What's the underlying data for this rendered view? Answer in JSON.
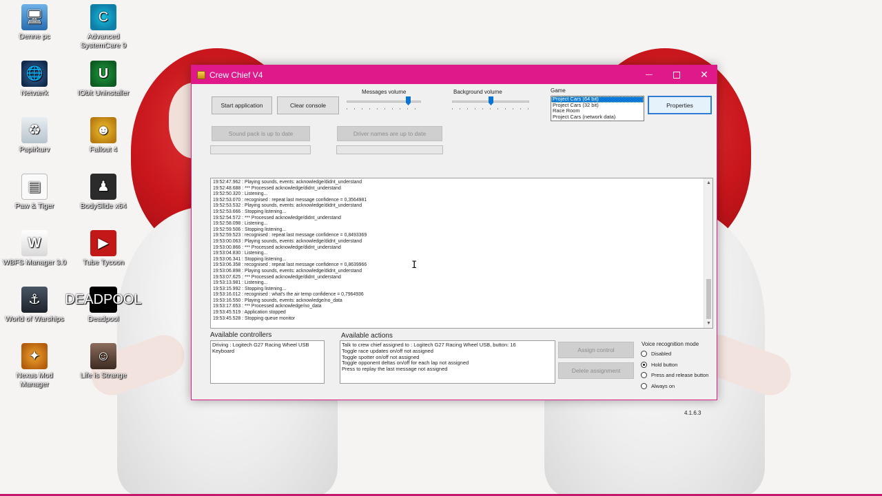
{
  "desktop": {
    "icons": [
      {
        "key": "pc",
        "label": "Denne pc",
        "glyph": "🖥"
      },
      {
        "key": "asc",
        "label": "Advanced SystemCare 9",
        "glyph": "C"
      },
      {
        "key": "net",
        "label": "Netværk",
        "glyph": "🌐"
      },
      {
        "key": "iobit",
        "label": "IObit Uninstaller",
        "glyph": "U"
      },
      {
        "key": "bin",
        "label": "Papirkurv",
        "glyph": "♻"
      },
      {
        "key": "fallout",
        "label": "Fallout 4",
        "glyph": "☻"
      },
      {
        "key": "paw",
        "label": "Paw & Tiger",
        "glyph": "▤"
      },
      {
        "key": "body",
        "label": "BodySlide x64",
        "glyph": "♟"
      },
      {
        "key": "wbfs",
        "label": "WBFS Manager 3.0",
        "glyph": "W"
      },
      {
        "key": "tube",
        "label": "Tube Tycoon",
        "glyph": "▶"
      },
      {
        "key": "wows",
        "label": "World of Warships",
        "glyph": "⚓"
      },
      {
        "key": "deadpool",
        "label": "Deadpool",
        "glyph": "DEADPOOL"
      },
      {
        "key": "nexus",
        "label": "Nexus Mod Manager",
        "glyph": "✦"
      },
      {
        "key": "life",
        "label": "Life is Strange",
        "glyph": "☺"
      }
    ]
  },
  "window": {
    "title": "Crew Chief V4",
    "controls": {
      "minimize": "—",
      "close": "✕"
    },
    "accent": "#e0198a"
  },
  "toolbar": {
    "start_label": "Start application",
    "clear_label": "Clear console",
    "messages_volume_label": "Messages volume",
    "background_volume_label": "Background volume",
    "messages_volume": 0.85,
    "background_volume": 0.5,
    "game_label": "Game",
    "properties_label": "Properties",
    "sound_pack_label": "Sound pack is up to date",
    "driver_names_label": "Driver names are up to date"
  },
  "games": [
    {
      "name": "Project Cars (64 bit)",
      "selected": true
    },
    {
      "name": "Project Cars (32 bit)",
      "selected": false
    },
    {
      "name": "Race Room",
      "selected": false
    },
    {
      "name": "Project Cars (network data)",
      "selected": false
    }
  ],
  "console": [
    "19:52:47.962 : Playing sounds, events: acknowledge/didnt_understand",
    "19:52:48.688 : *** Processed acknowledge/didnt_understand",
    "19:52:50.320 : Listening...",
    "19:52:53.070 : recognised : repeat last message confidence = 0,3564981",
    "19:52:53.532 : Playing sounds, events: acknowledge/didnt_understand",
    "19:52:53.666 : Stopping listening...",
    "19:52:54.572 : *** Processed acknowledge/didnt_understand",
    "19:52:58.098 : Listening...",
    "19:52:59.506 : Stopping listening...",
    "19:52:59.523 : recognised : repeat last message confidence = 0,8493369",
    "19:53:00.063 : Playing sounds, events: acknowledge/didnt_understand",
    "19:53:00.866 : *** Processed acknowledge/didnt_understand",
    "19:53:04.830 : Listening...",
    "19:53:06.341 : Stopping listening...",
    "19:53:06.358 : recognised : repeat last message confidence = 0,8639966",
    "19:53:06.898 : Playing sounds, events: acknowledge/didnt_understand",
    "19:53:07.625 : *** Processed acknowledge/didnt_understand",
    "19:53:13.981 : Listening...",
    "19:53:15.992 : Stopping listening...",
    "19:53:16.012 : recognised : what's the air temp confidence = 0,7964936",
    "19:53:16.550 : Playing sounds, events: acknowledge/no_data",
    "19:53:17.653 : *** Processed acknowledge/no_data",
    "19:53:45.519 : Application stopped",
    "19:53:45.528 : Stopping queue monitor"
  ],
  "scroll_arrows": {
    "up": "▲",
    "down": "▼"
  },
  "controllers": {
    "label": "Available controllers",
    "items": [
      "Driving : Logitech G27 Racing Wheel USB",
      "Keyboard"
    ]
  },
  "actions": {
    "label": "Available actions",
    "items": [
      "Talk to crew chief assigned to : Logitech G27 Racing Wheel USB, button: 16",
      "Toggle race updates on/off not assigned",
      "Toggle spotter on/off not assigned",
      "Toggle opponent deltas on/off for each lap not assigned",
      "Press to replay the last message not assigned"
    ],
    "assign_label": "Assign control",
    "delete_label": "Delete assignment"
  },
  "voice": {
    "label": "Voice recognition mode",
    "options": [
      {
        "label": "Disabled",
        "checked": false
      },
      {
        "label": "Hold button",
        "checked": true
      },
      {
        "label": "Press and release button",
        "checked": false
      },
      {
        "label": "Always on",
        "checked": false
      }
    ]
  },
  "version": "4.1.6.3"
}
